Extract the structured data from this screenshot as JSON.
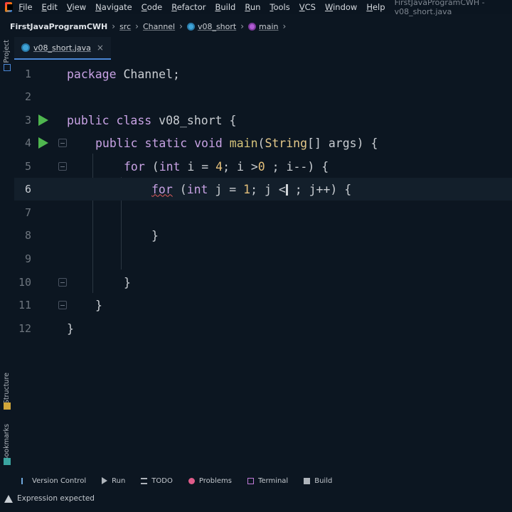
{
  "menu": {
    "items": [
      "File",
      "Edit",
      "View",
      "Navigate",
      "Code",
      "Refactor",
      "Build",
      "Run",
      "Tools",
      "VCS",
      "Window",
      "Help"
    ],
    "window_title": "FirstJavaProgramCWH - v08_short.java"
  },
  "breadcrumb": {
    "project": "FirstJavaProgramCWH",
    "src": "src",
    "package": "Channel",
    "class": "v08_short",
    "method": "main"
  },
  "left_strip": {
    "project": "Project",
    "structure": "Structure",
    "bookmarks": "Bookmarks"
  },
  "tab": {
    "name": "v08_short.java",
    "close": "×"
  },
  "editor": {
    "line_numbers": [
      "1",
      "2",
      "3",
      "4",
      "5",
      "6",
      "7",
      "8",
      "9",
      "10",
      "11",
      "12"
    ],
    "current_line": 6
  },
  "code": {
    "l1": {
      "kw": "package",
      "rest": " Channel;"
    },
    "l3": {
      "kw1": "public",
      "kw2": " class",
      "rest": " v08_short {"
    },
    "l4": {
      "kw1": "public",
      "kw2": " static",
      "kw3": " void",
      "fn": " main",
      "p1": "(",
      "cls": "String",
      "rest": "[] args) {"
    },
    "l5": {
      "kw": "for",
      "p1": " (",
      "kw2": "int",
      "p2": " i = ",
      "num1": "4",
      "p3": "; i >",
      "num2": "0",
      "p4": " ; i--) {"
    },
    "l6": {
      "kw": "for",
      "p1": " (",
      "kw2": "int",
      "p2": " j = ",
      "num1": "1",
      "p3": "; j <",
      "p4": " ; j++) {"
    },
    "l8": {
      "text": "}"
    },
    "l10": {
      "text": "}"
    },
    "l11": {
      "text": "}"
    },
    "l12": {
      "text": "}"
    }
  },
  "bottom_tools": [
    "Version Control",
    "Run",
    "TODO",
    "Problems",
    "Terminal",
    "Build"
  ],
  "status": {
    "message": "Expression expected"
  },
  "colors": {
    "background": "#0c1621",
    "keyword": "#cf8e6d",
    "run_icon": "#4fb64f",
    "error_underline": "#e05c5c"
  }
}
